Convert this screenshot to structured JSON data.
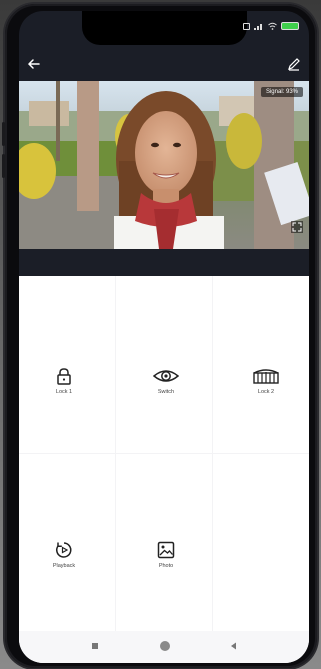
{
  "status_bar": {
    "icons": [
      "nfc-icon",
      "signal-icon",
      "wifi-icon",
      "battery-icon"
    ],
    "battery_color": "#3fcf4c"
  },
  "app_bar": {
    "back_icon": "arrow-left-icon",
    "edit_icon": "pencil-icon"
  },
  "video": {
    "signal_text": "Signal: 93%"
  },
  "actions": [
    {
      "label": "Lock 1",
      "icon": "padlock-icon"
    },
    {
      "label": "Switch",
      "icon": "eye-icon"
    },
    {
      "label": "Lock 2",
      "icon": "gate-icon"
    },
    {
      "label": "Playback",
      "icon": "playback-icon"
    },
    {
      "label": "Photo",
      "icon": "image-icon"
    }
  ],
  "nav": {
    "buttons": [
      "square-icon",
      "circle-icon",
      "back-triangle-icon"
    ]
  }
}
